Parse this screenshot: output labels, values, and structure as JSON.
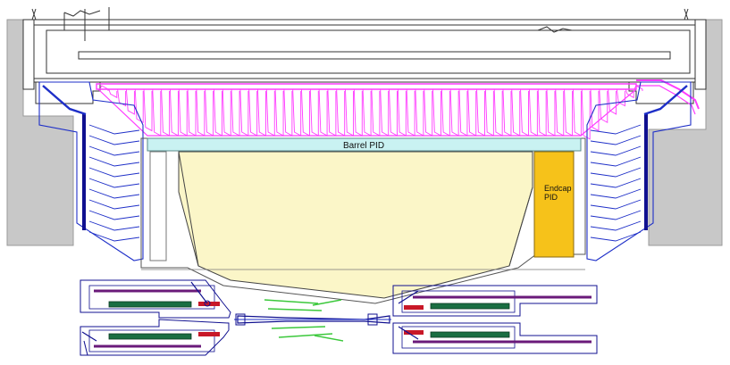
{
  "labels": {
    "barrel_pid": "Barrel PID",
    "endcap_pid_line1": "Endcap",
    "endcap_pid_line2": "PID"
  },
  "colors": {
    "background": "#ffffff",
    "concrete_gray": "#c8c8c8",
    "barrel_pid_fill": "#c9f2f2",
    "endcap_pid_fill": "#f6c21a",
    "inner_volume_fill": "#fbf6c8",
    "magenta_structure": "#ff3cff",
    "blue_structure": "#1e2fc8",
    "dark_blue": "#101090",
    "green_component": "#1a6e42",
    "light_green": "#3bc83b",
    "red_component": "#c81828",
    "purple_component": "#6a1a7a",
    "steel_line": "#6a7a80"
  }
}
